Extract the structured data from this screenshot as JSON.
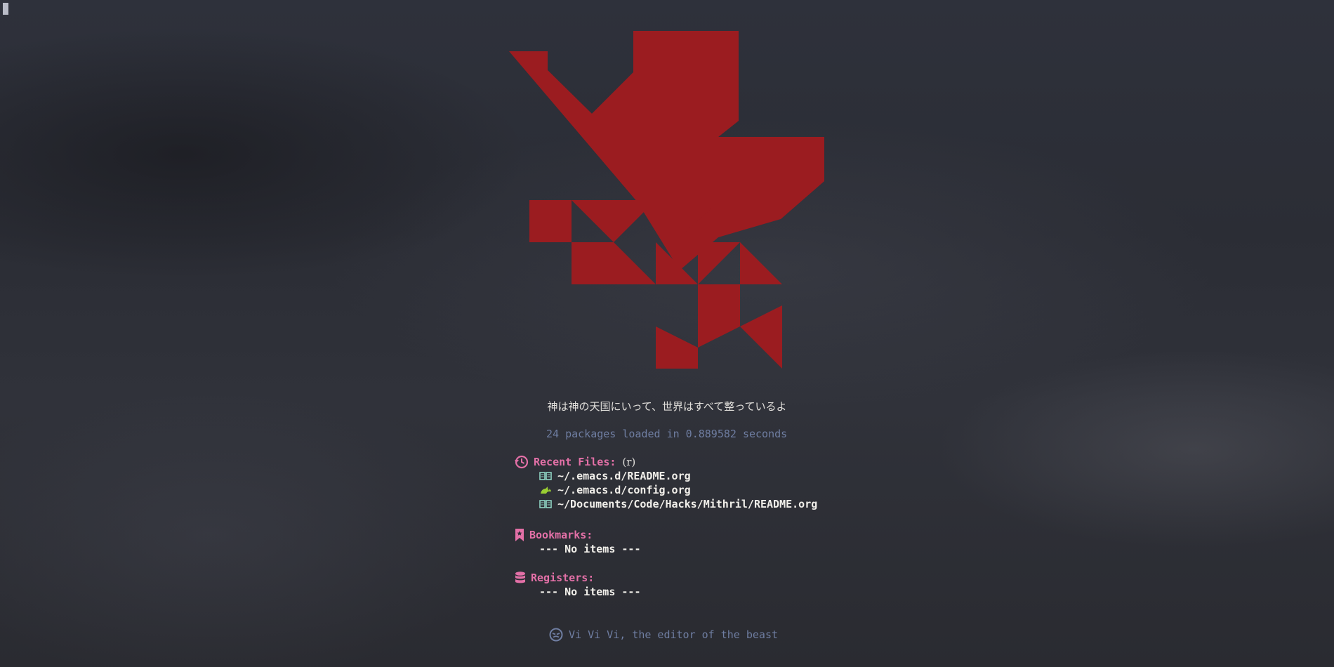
{
  "colors": {
    "logo_red": "#9b1c20",
    "accent_pink": "#e370a7",
    "muted_blue": "#6f7ea2",
    "text": "#f1efea"
  },
  "tagline": "神は神の天国にいって、世界はすべて整っているよ",
  "load_message": "24 packages loaded in 0.889582 seconds",
  "sections": {
    "recent": {
      "icon": "history-icon",
      "title": "Recent Files:",
      "shortcut": "(r)",
      "items": [
        {
          "icon": "book-icon",
          "path": "~/.emacs.d/README.org"
        },
        {
          "icon": "unicorn-icon",
          "path": "~/.emacs.d/config.org"
        },
        {
          "icon": "book-icon",
          "path": "~/Documents/Code/Hacks/Mithril/README.org"
        }
      ]
    },
    "bookmarks": {
      "icon": "bookmark-icon",
      "title": "Bookmarks:",
      "empty": "--- No items ---"
    },
    "registers": {
      "icon": "database-icon",
      "title": "Registers:",
      "empty": "--- No items ---"
    }
  },
  "footer": {
    "icon": "evil-icon",
    "text": "Vi Vi Vi, the editor of the beast"
  }
}
